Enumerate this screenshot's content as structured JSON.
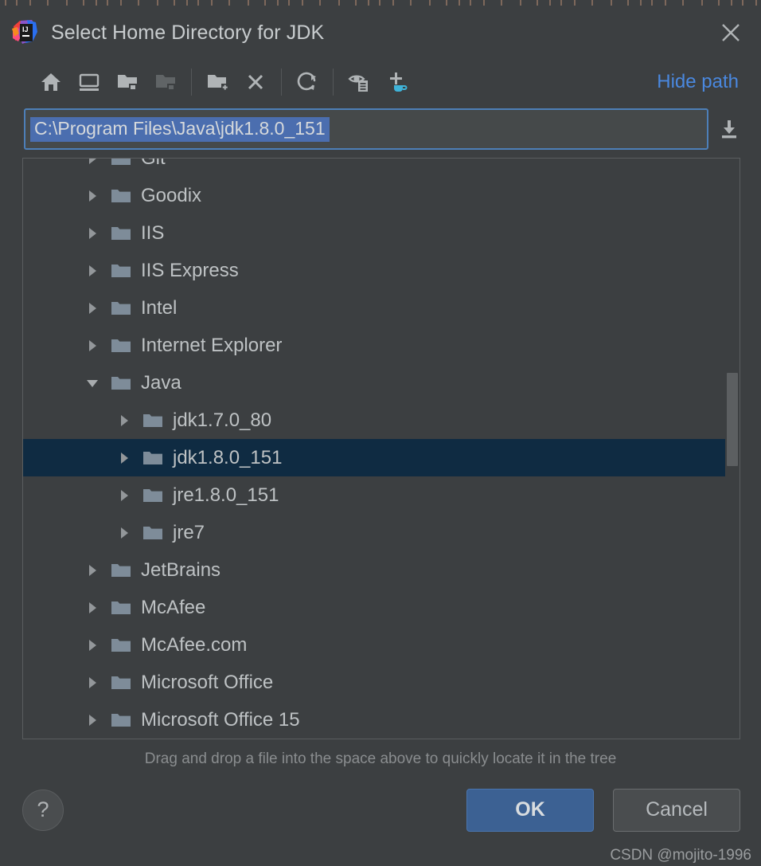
{
  "window": {
    "title": "Select Home Directory for JDK",
    "logo_icon": "intellij-idea-logo",
    "close_icon": "close-icon"
  },
  "toolbar": {
    "buttons": [
      {
        "name": "home-icon",
        "tooltip": "Home"
      },
      {
        "name": "desktop-icon",
        "tooltip": "Desktop"
      },
      {
        "name": "project-folder-icon",
        "tooltip": "Project Directory"
      },
      {
        "name": "module-folder-icon",
        "tooltip": "Module Directory"
      },
      {
        "name": "new-folder-icon",
        "tooltip": "New Folder"
      },
      {
        "name": "delete-icon",
        "tooltip": "Delete"
      },
      {
        "name": "refresh-icon",
        "tooltip": "Refresh"
      },
      {
        "name": "show-hidden-icon",
        "tooltip": "Show Hidden Files"
      },
      {
        "name": "add-jdk-icon",
        "tooltip": "Add JDK"
      }
    ],
    "hide_path_label": "Hide path"
  },
  "path": {
    "value": "C:\\Program Files\\Java\\jdk1.8.0_151",
    "placeholder": "",
    "selected": true,
    "download_icon": "download-icon"
  },
  "tree": {
    "nodes": [
      {
        "label": "Git",
        "depth": 1,
        "expanded": false,
        "selected": false,
        "clipped": true
      },
      {
        "label": "Goodix",
        "depth": 1,
        "expanded": false,
        "selected": false
      },
      {
        "label": "IIS",
        "depth": 1,
        "expanded": false,
        "selected": false
      },
      {
        "label": "IIS Express",
        "depth": 1,
        "expanded": false,
        "selected": false
      },
      {
        "label": "Intel",
        "depth": 1,
        "expanded": false,
        "selected": false
      },
      {
        "label": "Internet Explorer",
        "depth": 1,
        "expanded": false,
        "selected": false
      },
      {
        "label": "Java",
        "depth": 1,
        "expanded": true,
        "selected": false
      },
      {
        "label": "jdk1.7.0_80",
        "depth": 2,
        "expanded": false,
        "selected": false
      },
      {
        "label": "jdk1.8.0_151",
        "depth": 2,
        "expanded": false,
        "selected": true
      },
      {
        "label": "jre1.8.0_151",
        "depth": 2,
        "expanded": false,
        "selected": false
      },
      {
        "label": "jre7",
        "depth": 2,
        "expanded": false,
        "selected": false
      },
      {
        "label": "JetBrains",
        "depth": 1,
        "expanded": false,
        "selected": false
      },
      {
        "label": "McAfee",
        "depth": 1,
        "expanded": false,
        "selected": false
      },
      {
        "label": "McAfee.com",
        "depth": 1,
        "expanded": false,
        "selected": false
      },
      {
        "label": "Microsoft Office",
        "depth": 1,
        "expanded": false,
        "selected": false
      },
      {
        "label": "Microsoft Office 15",
        "depth": 1,
        "expanded": false,
        "selected": false
      }
    ],
    "scrollbar": {
      "thumb_top_pct": 37,
      "thumb_height_pct": 16
    }
  },
  "hint": "Drag and drop a file into the space above to quickly locate it in the tree",
  "footer": {
    "help_label": "?",
    "ok_label": "OK",
    "cancel_label": "Cancel"
  },
  "watermark": "CSDN @mojito-1996",
  "colors": {
    "dialog_bg": "#3C3F41",
    "selection_row": "#0F2B42",
    "text_selection": "#4B6EAF",
    "accent_link": "#4A88DF",
    "ok_button": "#3C6193",
    "folder": "#7E8C99",
    "jdk_accent": "#3FB3D9"
  }
}
